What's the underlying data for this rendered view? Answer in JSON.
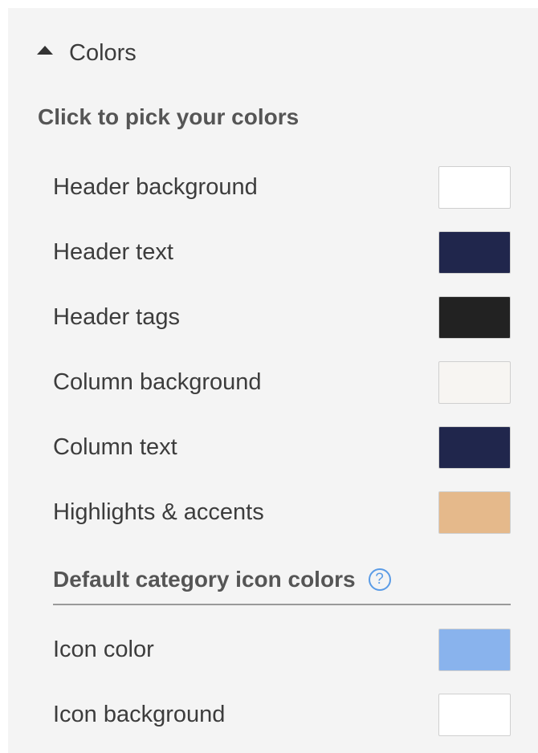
{
  "section": {
    "title": "Colors",
    "subheading": "Click to pick your colors"
  },
  "colors": [
    {
      "label": "Header background",
      "color": "#ffffff"
    },
    {
      "label": "Header text",
      "color": "#20264c"
    },
    {
      "label": "Header tags",
      "color": "#222222"
    },
    {
      "label": "Column background",
      "color": "#f7f5f2"
    },
    {
      "label": "Column text",
      "color": "#20264c"
    },
    {
      "label": "Highlights & accents",
      "color": "#e5b98b"
    }
  ],
  "icon_colors": {
    "heading": "Default category icon colors",
    "help_glyph": "?",
    "items": [
      {
        "label": "Icon color",
        "color": "#89b3ed"
      },
      {
        "label": "Icon background",
        "color": "#ffffff"
      }
    ]
  }
}
